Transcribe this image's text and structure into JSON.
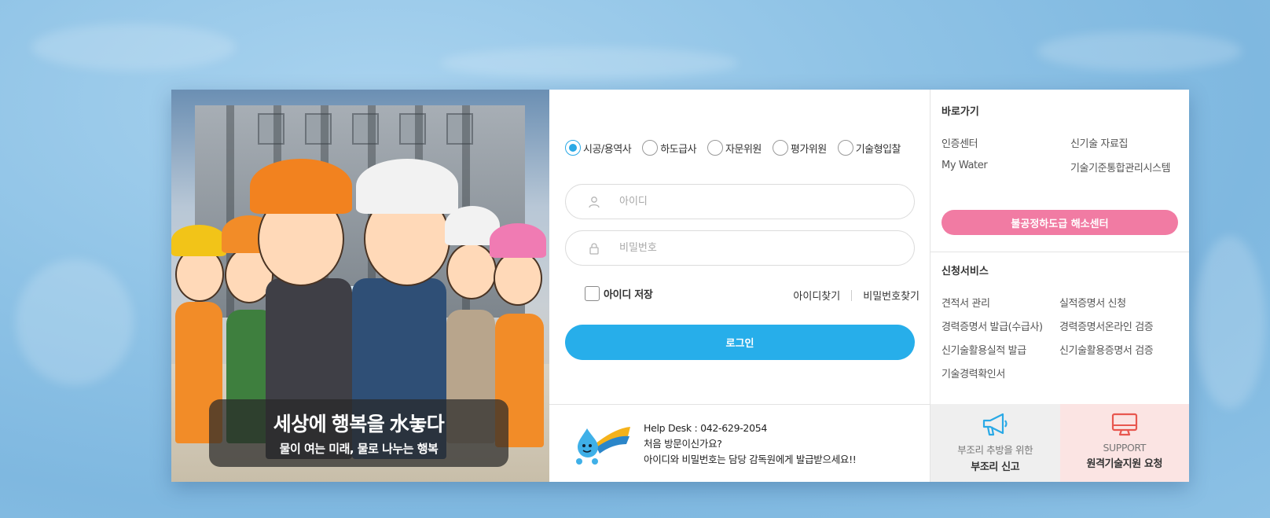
{
  "hero": {
    "title": "세상에 행복을 水놓다",
    "subtitle": "물이 여는 미래, 물로 나누는 행복"
  },
  "login": {
    "user_types": [
      {
        "label": "시공/용역사",
        "selected": true
      },
      {
        "label": "하도급사",
        "selected": false
      },
      {
        "label": "자문위원",
        "selected": false
      },
      {
        "label": "평가위원",
        "selected": false
      },
      {
        "label": "기술형입찰",
        "selected": false
      }
    ],
    "id_placeholder": "아이디",
    "pw_placeholder": "비밀번호",
    "save_id_label": "아이디 저장",
    "find_id_label": "아이디찾기",
    "find_pw_label": "비밀번호찾기",
    "login_button": "로그인",
    "accent_color": "#27aeea"
  },
  "helpdesk": {
    "line1": "Help Desk : 042-629-2054",
    "line2": "처음 방문이신가요?",
    "line3": "아이디와 비밀번호는 담당 감독원에게 발급받으세요!!"
  },
  "shortcuts": {
    "title": "바로가기",
    "links": [
      "인증센터",
      "신기술 자료집",
      "My Water",
      "기술기준통합관리시스템"
    ],
    "pink_button": "불공정하도급 해소센터",
    "pink_color": "#f17ba3"
  },
  "services": {
    "title": "신청서비스",
    "links": [
      "견적서 관리",
      "실적증명서 신청",
      "경력증명서 발급(수급사)",
      "경력증명서온라인 검증",
      "신기술활용실적 발급",
      "신기술활용증명서 검증",
      "기술경력확인서"
    ]
  },
  "bottom_buttons": [
    {
      "icon": "megaphone-icon",
      "sub": "부조리 추방을 위한",
      "main": "부조리 신고"
    },
    {
      "icon": "monitor-icon",
      "sub": "SUPPORT",
      "main": "원격기술지원 요청"
    }
  ]
}
